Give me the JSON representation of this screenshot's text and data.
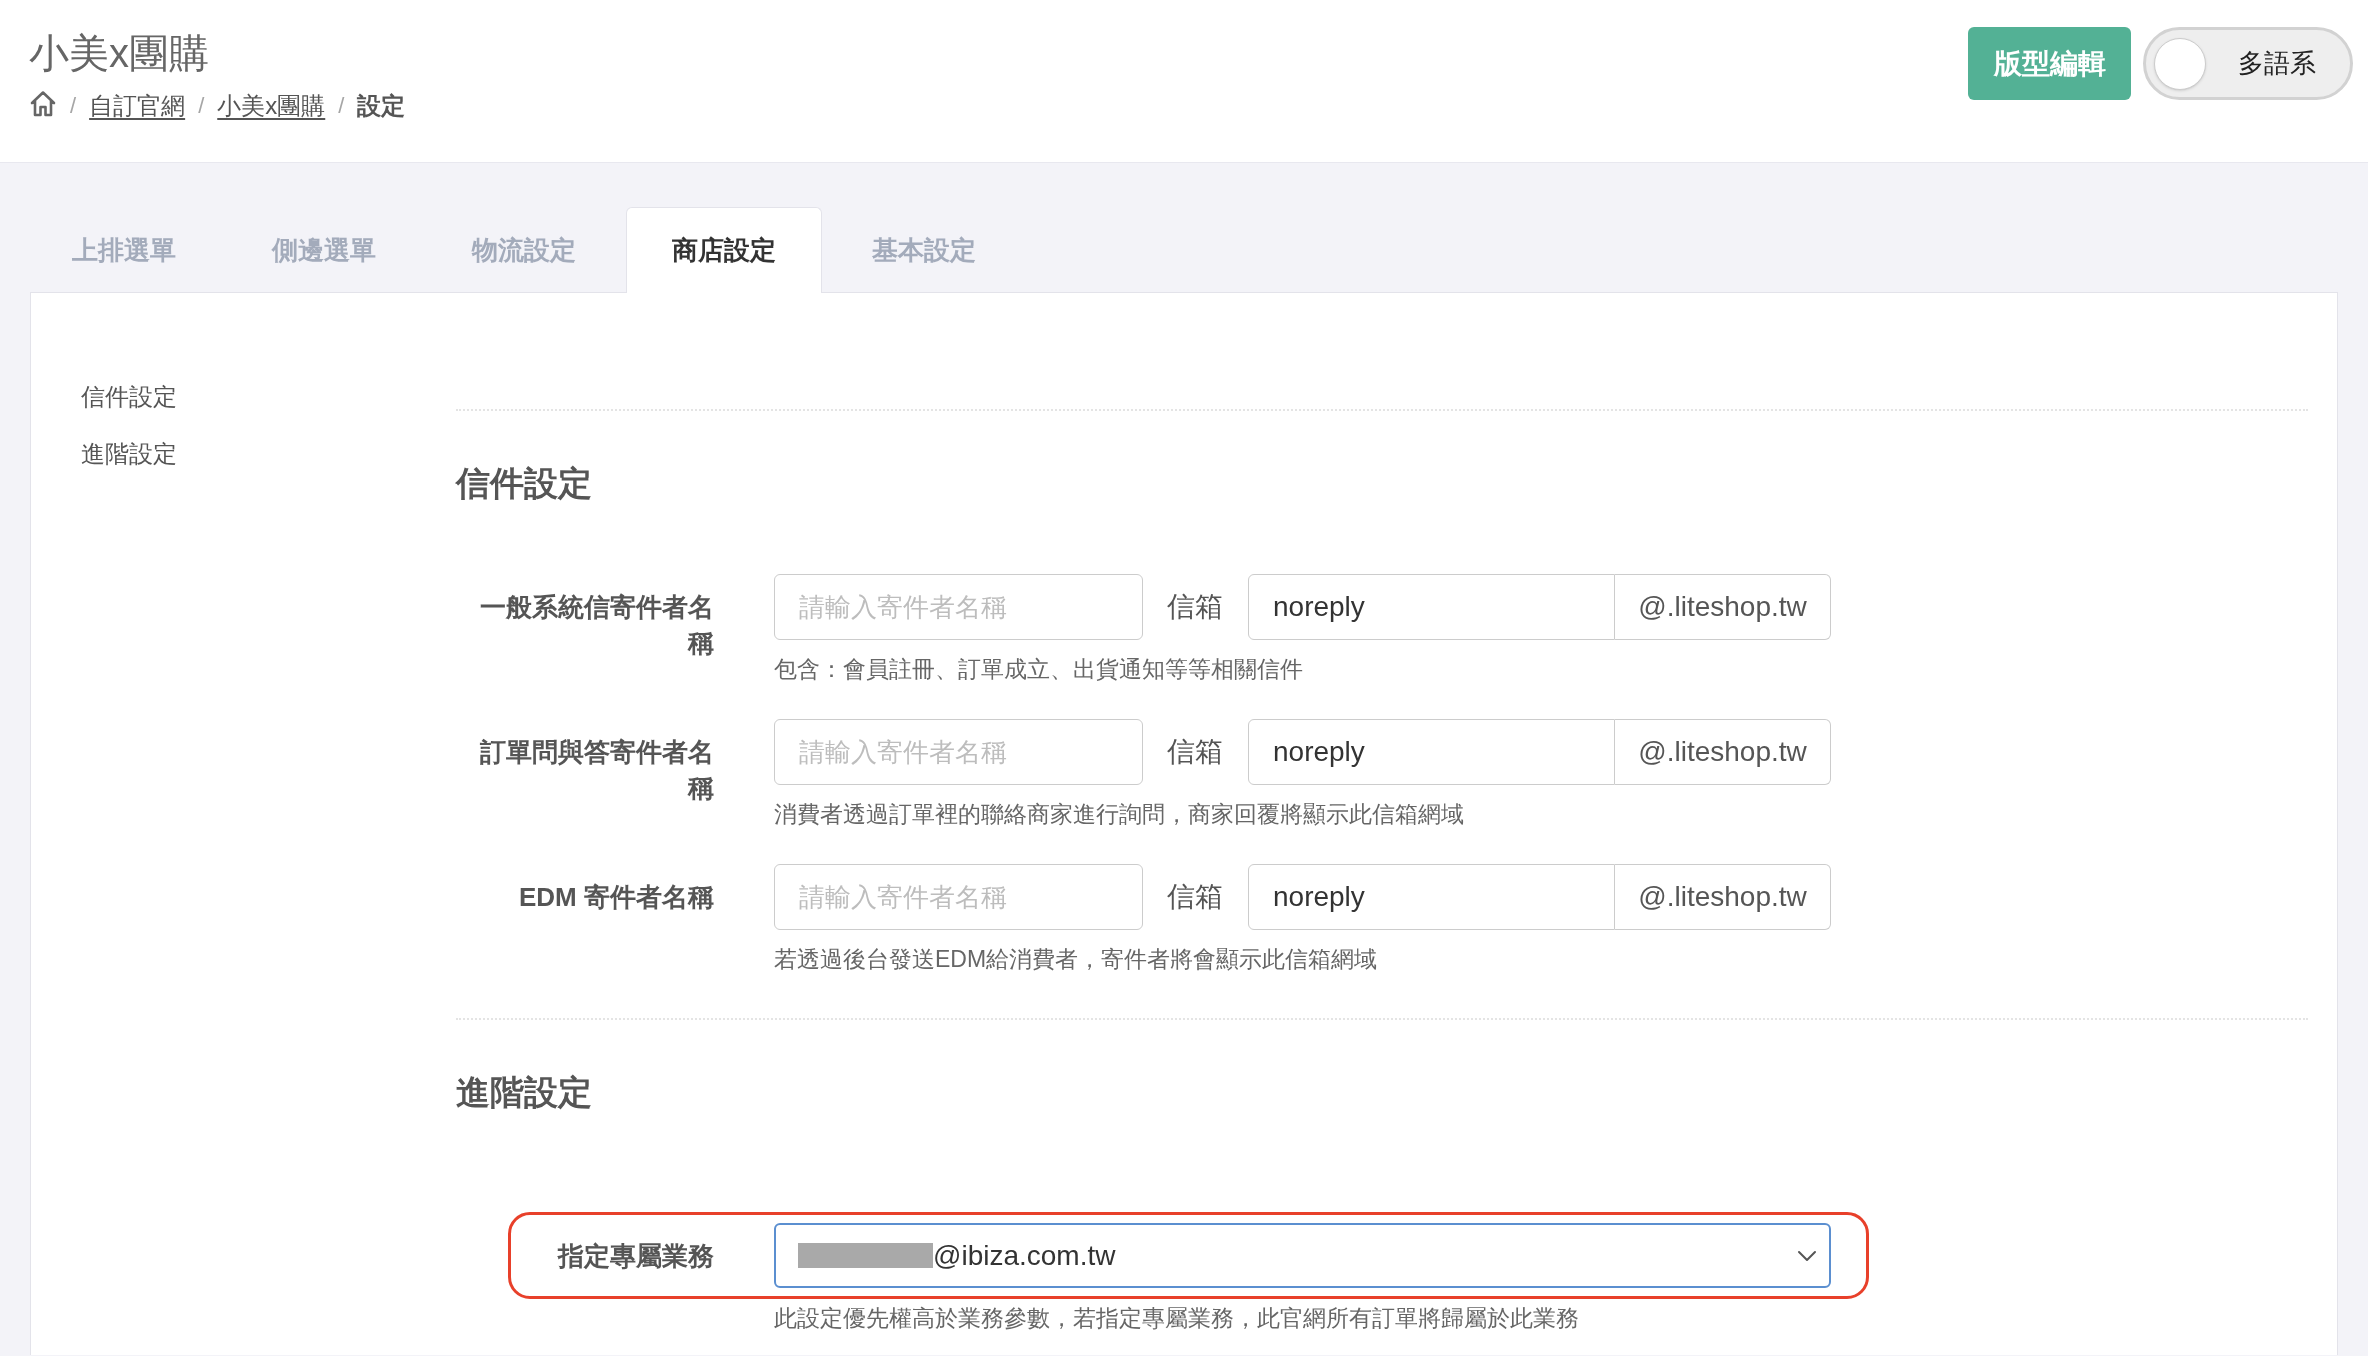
{
  "header": {
    "title": "小美x團購",
    "breadcrumb": [
      {
        "kind": "home"
      },
      {
        "kind": "link",
        "separator": "/",
        "label": "自訂官網"
      },
      {
        "kind": "link",
        "separator": "/",
        "label": "小美x團購"
      },
      {
        "kind": "current",
        "separator": "/",
        "label": "設定"
      }
    ],
    "edit_button": "版型編輯",
    "language_toggle": {
      "label": "多語系",
      "on": false
    }
  },
  "tabs": [
    {
      "label": "上排選單",
      "selected": false
    },
    {
      "label": "側邊選單",
      "selected": false
    },
    {
      "label": "物流設定",
      "selected": false
    },
    {
      "label": "商店設定",
      "selected": true
    },
    {
      "label": "基本設定",
      "selected": false
    }
  ],
  "side_nav": {
    "items": [
      {
        "label": "信件設定"
      },
      {
        "label": "進階設定"
      }
    ]
  },
  "sections": [
    {
      "heading": "信件設定",
      "fields": [
        {
          "kind": "sender",
          "label": "一般系統信寄件者名稱",
          "placeholder": "請輸入寄件者名稱",
          "mailbox_label": "信箱",
          "mailbox_value": "noreply",
          "domain": "@.liteshop.tw",
          "help": "包含：會員註冊、訂單成立、出貨通知等等相關信件"
        },
        {
          "kind": "sender",
          "label": "訂單問與答寄件者名稱",
          "placeholder": "請輸入寄件者名稱",
          "mailbox_label": "信箱",
          "mailbox_value": "noreply",
          "domain": "@.liteshop.tw",
          "help": "消費者透過訂單裡的聯絡商家進行詢問，商家回覆將顯示此信箱網域"
        },
        {
          "kind": "sender",
          "label": "EDM 寄件者名稱",
          "placeholder": "請輸入寄件者名稱",
          "mailbox_label": "信箱",
          "mailbox_value": "noreply",
          "domain": "@.liteshop.tw",
          "help": "若透過後台發送EDM給消費者，寄件者將會顯示此信箱網域"
        }
      ]
    },
    {
      "heading": "進階設定",
      "fields": [
        {
          "kind": "select",
          "label": "指定專屬業務",
          "value": "@ibiza.com.tw",
          "redacted": true,
          "highlighted": true,
          "help": "此設定優先權高於業務參數，若指定專屬業務，此官網所有訂單將歸屬於此業務"
        }
      ]
    }
  ]
}
